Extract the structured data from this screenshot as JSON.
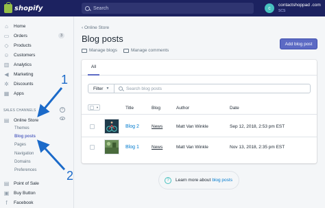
{
  "topbar": {
    "logo_text": "shopify",
    "search_placeholder": "Search",
    "avatar_letter": "c",
    "store_name": "contactshoppad .com",
    "store_sub": "SCS"
  },
  "sidebar": {
    "items": [
      {
        "label": "Home",
        "icon": "home-icon",
        "glyph": "⌂"
      },
      {
        "label": "Orders",
        "icon": "orders-icon",
        "glyph": "▭",
        "badge": "3"
      },
      {
        "label": "Products",
        "icon": "tag-icon",
        "glyph": "◇"
      },
      {
        "label": "Customers",
        "icon": "customers-icon",
        "glyph": "☺"
      },
      {
        "label": "Analytics",
        "icon": "analytics-icon",
        "glyph": "▥"
      },
      {
        "label": "Marketing",
        "icon": "megaphone-icon",
        "glyph": "◀"
      },
      {
        "label": "Discounts",
        "icon": "discount-icon",
        "glyph": "✲"
      },
      {
        "label": "Apps",
        "icon": "apps-icon",
        "glyph": "▦"
      }
    ],
    "sales_channels_label": "SALES CHANNELS",
    "online_store_label": "Online Store",
    "sub_items": [
      "Themes",
      "Blog posts",
      "Pages",
      "Navigation",
      "Domains",
      "Preferences"
    ],
    "channels": [
      {
        "label": "Point of Sale",
        "icon": "pos-icon",
        "glyph": "▤"
      },
      {
        "label": "Buy Button",
        "icon": "buy-button-icon",
        "glyph": "▣"
      },
      {
        "label": "Facebook",
        "icon": "facebook-icon",
        "glyph": "f"
      }
    ]
  },
  "annotations": {
    "one": "1",
    "two": "2"
  },
  "main": {
    "breadcrumb": "Online Store",
    "title": "Blog posts",
    "manage_blogs": "Manage blogs",
    "manage_comments": "Manage comments",
    "add_button": "Add blog post",
    "tab_all": "All",
    "filter_label": "Filter",
    "search_placeholder": "Search blog posts",
    "columns": [
      "Title",
      "Blog",
      "Author",
      "Date"
    ],
    "rows": [
      {
        "title": "Blog 2",
        "blog": "News",
        "author": "Matt Van Winkle",
        "date": "Sep 12, 2018, 2:53 pm EST"
      },
      {
        "title": "Blog 1",
        "blog": "News",
        "author": "Matt Van Winkle",
        "date": "Nov 13, 2018, 2:35 pm EST"
      }
    ],
    "help_text": "Learn more about",
    "help_link": "blog posts"
  },
  "colors": {
    "topbar": "#1c2260",
    "accent": "#5c6ac4",
    "link": "#007ace",
    "annotation": "#1b6ac9"
  }
}
